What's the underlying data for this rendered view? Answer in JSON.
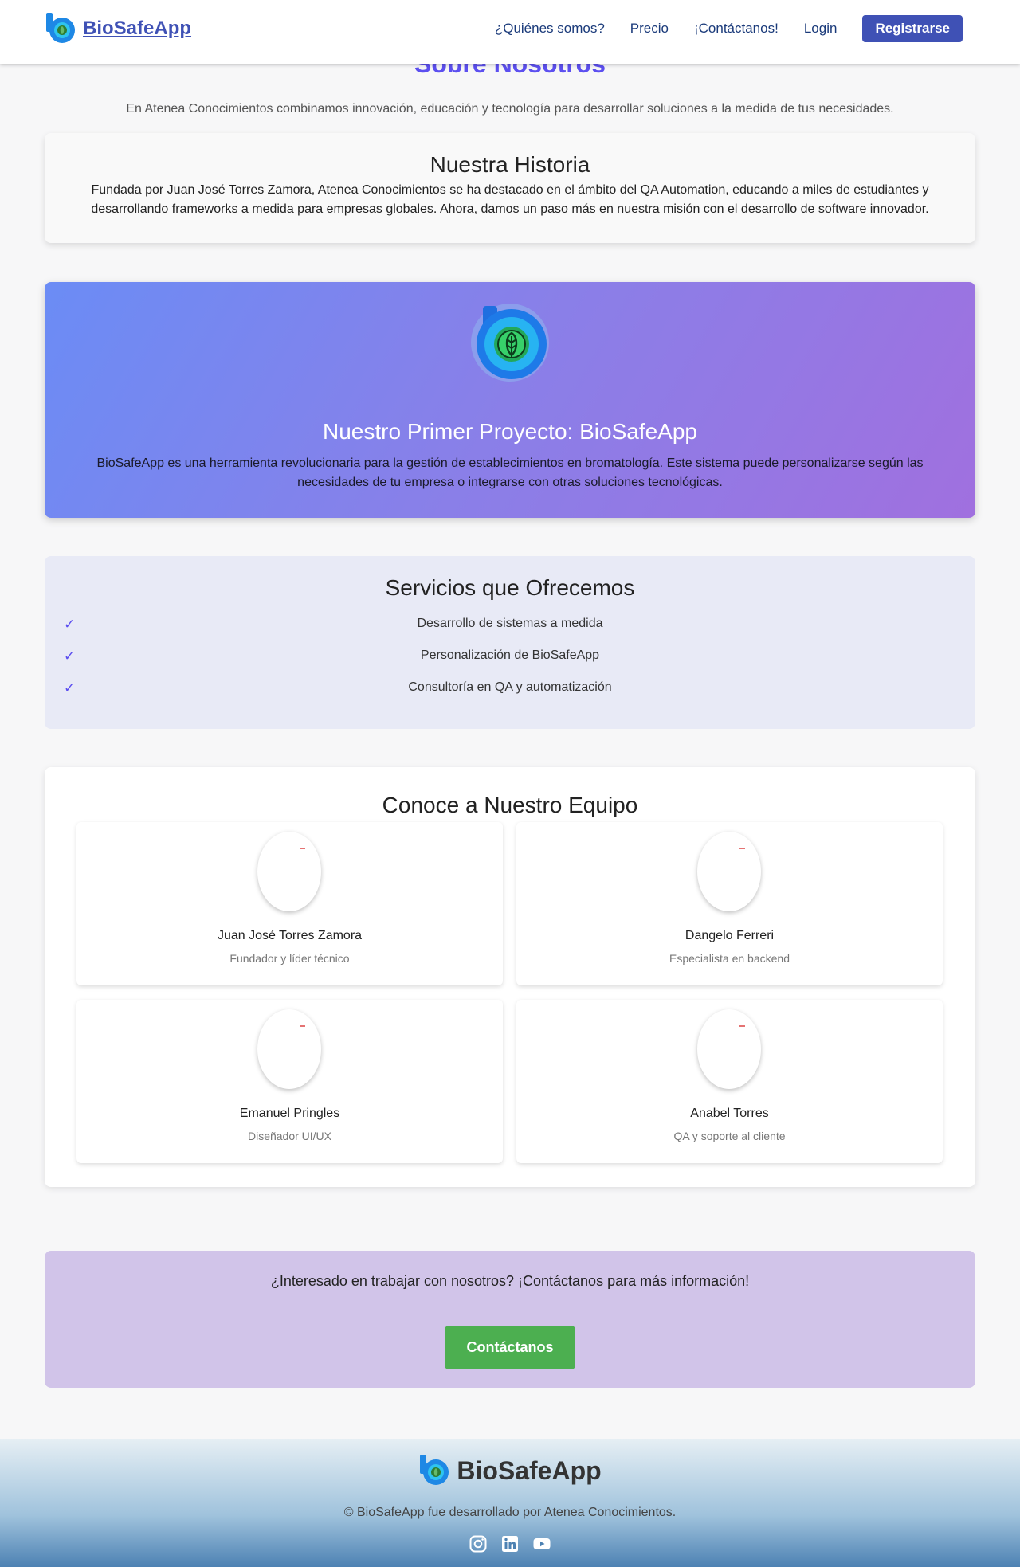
{
  "nav": {
    "brand": "BioSafeApp",
    "links": [
      "¿Quiénes somos?",
      "Precio",
      "¡Contáctanos!",
      "Login"
    ],
    "register_label": "Registrarse"
  },
  "hero": {
    "title": "Sobre Nosotros",
    "subtitle": "En Atenea Conocimientos combinamos innovación, educación y tecnología para desarrollar soluciones a la medida de tus necesidades."
  },
  "history": {
    "title": "Nuestra Historia",
    "text": "Fundada por Juan José Torres Zamora, Atenea Conocimientos se ha destacado en el ámbito del QA Automation, educando a miles de estudiantes y desarrollando frameworks a medida para empresas globales. Ahora, damos un paso más en nuestra misión con el desarrollo de software innovador."
  },
  "project": {
    "title": "Nuestro Primer Proyecto: BioSafeApp",
    "text": "BioSafeApp es una herramienta revolucionaria para la gestión de establecimientos en bromatología. Este sistema puede personalizarse según las necesidades de tu empresa o integrarse con otras soluciones tecnológicas."
  },
  "services": {
    "title": "Servicios que Ofrecemos",
    "check": "✓",
    "items": [
      "Desarrollo de sistemas a medida",
      "Personalización de BioSafeApp",
      "Consultoría en QA y automatización"
    ]
  },
  "team": {
    "title": "Conoce a Nuestro Equipo",
    "members": [
      {
        "name": "Juan José Torres Zamora",
        "role": "Fundador y líder técnico"
      },
      {
        "name": "Dangelo Ferreri",
        "role": "Especialista en backend"
      },
      {
        "name": "Emanuel Pringles",
        "role": "Diseñador UI/UX"
      },
      {
        "name": "Anabel Torres",
        "role": "QA y soporte al cliente"
      }
    ]
  },
  "cta": {
    "text": "¿Interesado en trabajar con nosotros? ¡Contáctanos para más información!",
    "button": "Contáctanos"
  },
  "footer": {
    "brand": "BioSafeApp",
    "copyright": "© BioSafeApp fue desarrollado por Atenea Conocimientos.",
    "social_icons": [
      "instagram-icon",
      "linkedin-icon",
      "youtube-icon"
    ]
  },
  "colors": {
    "primary": "#3f51b5",
    "accent": "#5c4ff0",
    "cta_button": "#4caf50",
    "services_bg": "#e8eaf6",
    "cta_bg": "#d1c4e9"
  }
}
